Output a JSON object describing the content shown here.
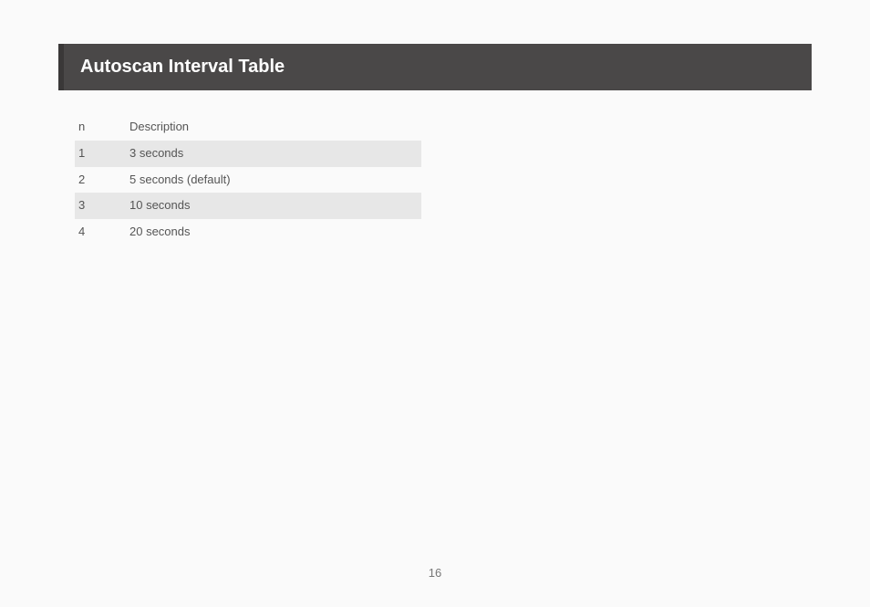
{
  "header": {
    "title": "Autoscan Interval Table"
  },
  "table": {
    "headers": {
      "n": "n",
      "description": "Description"
    },
    "rows": [
      {
        "n": "1",
        "description": "3 seconds"
      },
      {
        "n": "2",
        "description": "5 seconds (default)"
      },
      {
        "n": "3",
        "description": "10 seconds"
      },
      {
        "n": "4",
        "description": "20 seconds"
      }
    ]
  },
  "page_number": "16"
}
